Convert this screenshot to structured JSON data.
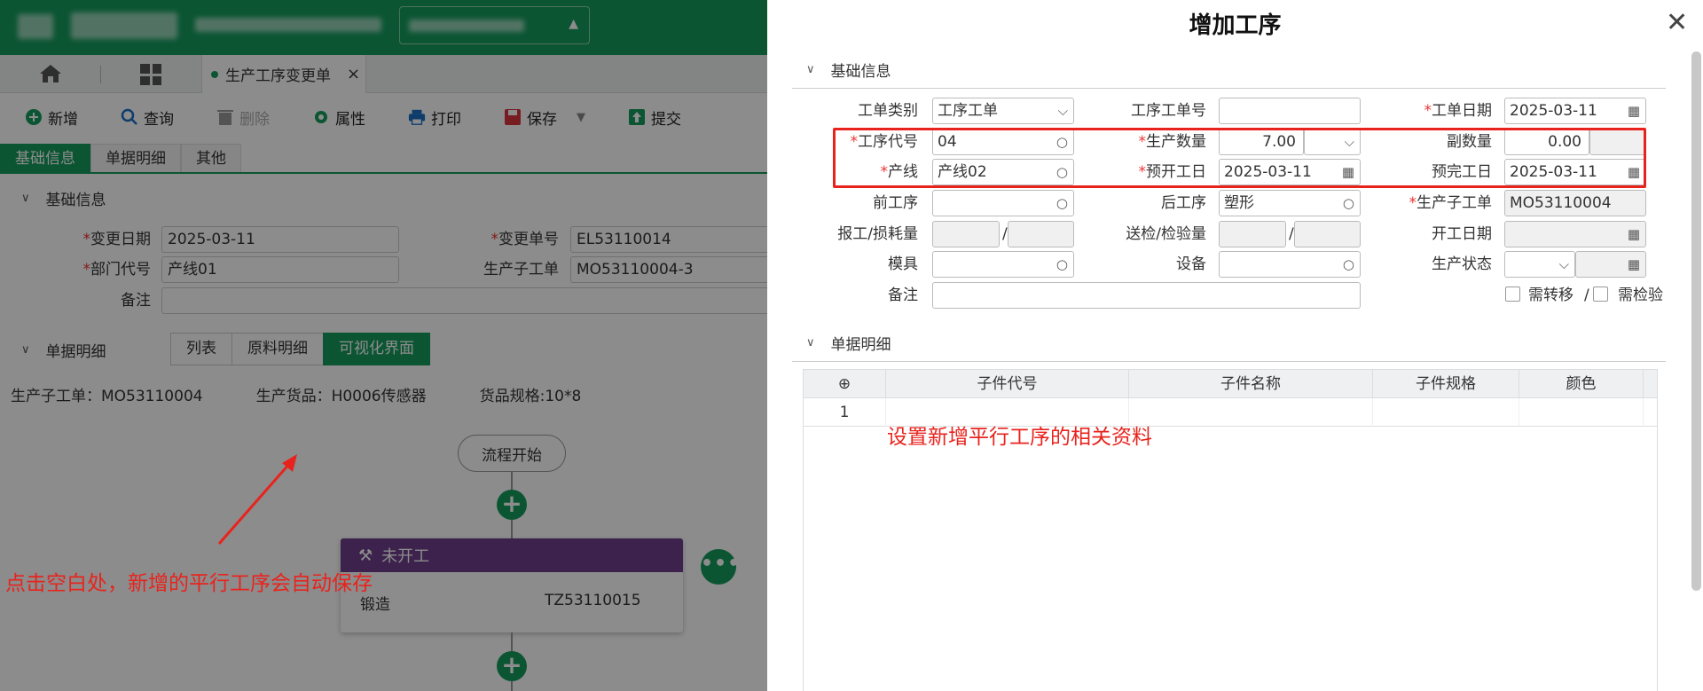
{
  "left": {
    "tab": {
      "label": "生产工序变更单"
    },
    "toolbar": {
      "add": "新增",
      "query": "查询",
      "delete": "删除",
      "props": "属性",
      "print": "打印",
      "save": "保存",
      "submit": "提交"
    },
    "subtabs": [
      "基础信息",
      "单据明细",
      "其他"
    ],
    "basic_section": "基础信息",
    "fields": {
      "change_date_label": "变更日期",
      "change_date": "2025-03-11",
      "change_no_label": "变更单号",
      "change_no": "EL53110014",
      "dept_label": "部门代号",
      "dept": "产线01",
      "sub_order_label": "生产子工单",
      "sub_order": "MO53110004-3",
      "remark_label": "备注"
    },
    "detail_section": "单据明细",
    "view_tabs": [
      "列表",
      "原料明细",
      "可视化界面"
    ],
    "info": {
      "sub_order": "生产子工单：MO53110004",
      "goods": "生产货品：H0006传感器",
      "spec": "货品规格:10*8"
    },
    "flow_start": "流程开始",
    "card": {
      "status": "未开工",
      "process": "锻造",
      "code": "TZ53110015"
    }
  },
  "annotations": {
    "left_note": "点击空白处，新增的平行工序会自动保存",
    "right_note": "设置新增平行工序的相关资料"
  },
  "dialog": {
    "title": "增加工序",
    "section_basic": "基础信息",
    "section_detail": "单据明细",
    "labels": {
      "order_type": "工单类别",
      "op_order_no": "工序工单号",
      "order_date": "工单日期",
      "op_code": "工序代号",
      "prod_qty": "生产数量",
      "sub_qty": "副数量",
      "line": "产线",
      "plan_start": "预开工日",
      "plan_end": "预完工日",
      "prev_op": "前工序",
      "next_op": "后工序",
      "sub_order": "生产子工单",
      "report_loss": "报工/损耗量",
      "send_inspect": "送检/检验量",
      "start_date": "开工日期",
      "mold": "模具",
      "equipment": "设备",
      "prod_status": "生产状态",
      "remark": "备注",
      "need_transfer": "需转移",
      "need_inspect": "需检验"
    },
    "values": {
      "order_type": "工序工单",
      "order_date": "2025-03-11",
      "op_code": "04",
      "prod_qty": "7.00",
      "sub_qty": "0.00",
      "line": "产线02",
      "plan_start": "2025-03-11",
      "plan_end": "2025-03-11",
      "next_op": "塑形",
      "sub_order": "MO53110004"
    },
    "table": {
      "headers": [
        "子件代号",
        "子件名称",
        "子件规格",
        "颜色"
      ],
      "rows": [
        {
          "index": "1"
        }
      ]
    }
  }
}
